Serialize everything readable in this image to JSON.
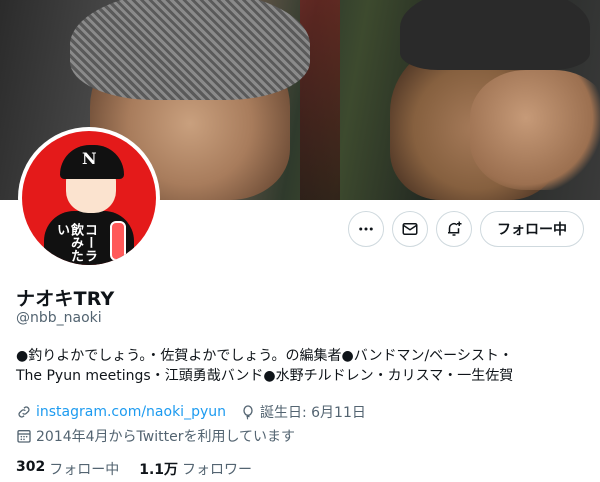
{
  "profile": {
    "display_name": "ナオキTRY",
    "handle": "@nbb_naoki",
    "bio_line1": "●釣りよかでしょう。・佐賀よかでしょう。の編集者●バンドマン/ベーシスト・",
    "bio_line2": "The Pyun meetings・江頭勇哉バンド●水野チルドレン・カリスマ・一生佐賀",
    "website": "instagram.com/naoki_pyun",
    "birthday": "誕生日: 6月11日",
    "joined": "2014年4月からTwitterを利用しています"
  },
  "avatar_text": "コーラ飲みたい",
  "avatar_cap_letter": "N",
  "actions": {
    "more_icon": "more-icon",
    "message_icon": "mail-icon",
    "notify_icon": "bell-plus-icon",
    "follow_label": "フォロー中"
  },
  "stats": {
    "following_count": "302",
    "following_label": "フォロー中",
    "followers_count": "1.1万",
    "followers_label": "フォロワー"
  },
  "colors": {
    "accent": "#1d9bf0",
    "text_primary": "#0f1419",
    "text_secondary": "#536471",
    "avatar_bg": "#e41a1a"
  }
}
